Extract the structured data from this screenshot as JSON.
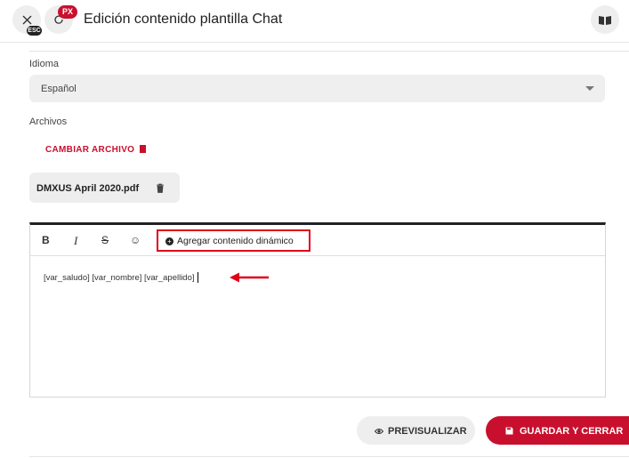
{
  "header": {
    "title": "Edición contenido plantilla Chat",
    "esc_badge": "ESC",
    "px_badge": "PX"
  },
  "form": {
    "language_label": "Idioma",
    "language_value": "Español",
    "files_label": "Archivos",
    "change_file_label": "CAMBIAR ARCHIVO",
    "file_name": "DMXUS April 2020.pdf"
  },
  "editor": {
    "toolbar": {
      "bold": "B",
      "italic": "I",
      "strike": "S",
      "emoji": "☺",
      "dynamic_content": "Agregar contenido dinámico"
    },
    "content": "[var_saludo] [var_nombre] [var_apellido]"
  },
  "actions": {
    "preview_label": "PREVISUALIZAR",
    "save_label": "GUARDAR Y CERRAR"
  },
  "colors": {
    "accent": "#c8102e",
    "highlight_box": "#e0001a"
  }
}
